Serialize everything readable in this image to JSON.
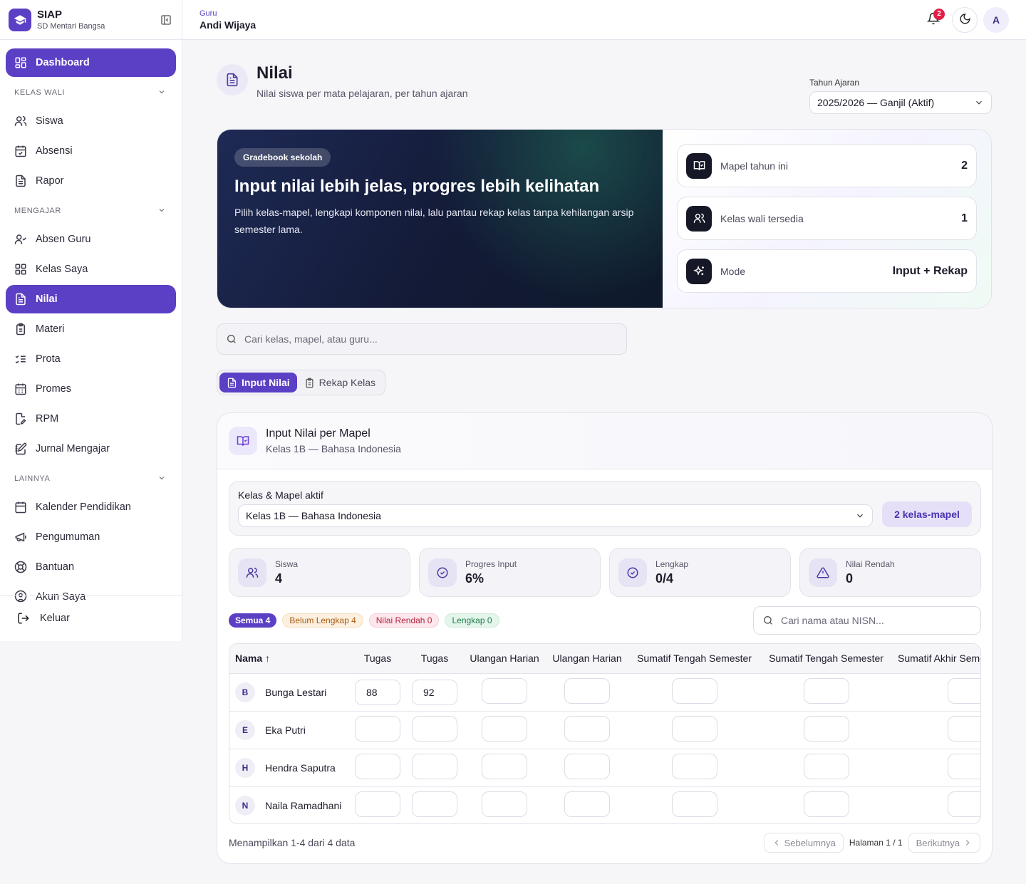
{
  "brand": {
    "name": "SIAP",
    "school": "SD Mentari Bangsa"
  },
  "sidebar": {
    "dashboard": "Dashboard",
    "sections": [
      {
        "title": "KELAS WALI",
        "items": [
          "Siswa",
          "Absensi",
          "Rapor"
        ]
      },
      {
        "title": "MENGAJAR",
        "items": [
          "Absen Guru",
          "Kelas Saya",
          "Nilai",
          "Materi",
          "Prota",
          "Promes",
          "RPM",
          "Jurnal Mengajar"
        ]
      },
      {
        "title": "LAINNYA",
        "items": [
          "Kalender Pendidikan",
          "Pengumuman",
          "Bantuan",
          "Akun Saya"
        ]
      }
    ],
    "logout": "Keluar"
  },
  "topbar": {
    "role": "Guru",
    "user_name": "Andi Wijaya",
    "notif_count": "2",
    "avatar_initial": "A"
  },
  "page": {
    "title": "Nilai",
    "subtitle": "Nilai siswa per mata pelajaran, per tahun ajaran",
    "year_label": "Tahun Ajaran",
    "year_value": "2025/2026 — Ganjil (Aktif)"
  },
  "hero": {
    "chip": "Gradebook sekolah",
    "title": "Input nilai lebih jelas, progres lebih kelihatan",
    "desc": "Pilih kelas-mapel, lengkapi komponen nilai, lalu pantau rekap kelas tanpa kehilangan arsip semester lama.",
    "stats": [
      {
        "label": "Mapel tahun ini",
        "value": "2",
        "icon": "book-check-icon"
      },
      {
        "label": "Kelas wali tersedia",
        "value": "1",
        "icon": "users-icon"
      },
      {
        "label": "Mode",
        "value": "Input + Rekap",
        "icon": "sparkles-icon"
      }
    ]
  },
  "search": {
    "placeholder": "Cari kelas, mapel, atau guru..."
  },
  "tabs": {
    "input": "Input Nilai",
    "rekap": "Rekap Kelas"
  },
  "card": {
    "title": "Input Nilai per Mapel",
    "subtitle": "Kelas 1B — Bahasa Indonesia",
    "filter_label": "Kelas & Mapel aktif",
    "filter_value": "Kelas 1B — Bahasa Indonesia",
    "filter_count": "2 kelas-mapel",
    "kpis": [
      {
        "label": "Siswa",
        "value": "4"
      },
      {
        "label": "Progres Input",
        "value": "6%"
      },
      {
        "label": "Lengkap",
        "value": "0/4"
      },
      {
        "label": "Nilai Rendah",
        "value": "0"
      }
    ],
    "chips": [
      "Semua 4",
      "Belum Lengkap 4",
      "Nilai Rendah 0",
      "Lengkap 0"
    ],
    "student_search_placeholder": "Cari nama atau NISN...",
    "table": {
      "headers": [
        "Nama ↑",
        "Tugas",
        "Tugas",
        "Ulangan Harian",
        "Ulangan Harian",
        "Sumatif Tengah Semester",
        "Sumatif Tengah Semester",
        "Sumatif Akhir Semester"
      ],
      "rows": [
        {
          "initial": "B",
          "name": "Bunga Lestari",
          "scores": [
            "88",
            "92",
            "",
            "",
            "",
            "",
            ""
          ]
        },
        {
          "initial": "E",
          "name": "Eka Putri",
          "scores": [
            "",
            "",
            "",
            "",
            "",
            "",
            ""
          ]
        },
        {
          "initial": "H",
          "name": "Hendra Saputra",
          "scores": [
            "",
            "",
            "",
            "",
            "",
            "",
            ""
          ]
        },
        {
          "initial": "N",
          "name": "Naila Ramadhani",
          "scores": [
            "",
            "",
            "",
            "",
            "",
            "",
            ""
          ]
        }
      ]
    },
    "footer_info": "Menampilkan 1-4 dari 4 data",
    "pager": {
      "prev": "Sebelumnya",
      "info": "Halaman 1 / 1",
      "next": "Berikutnya"
    }
  },
  "colors": {
    "accent": "#5b3fc4",
    "hero_dark": "#131a36",
    "danger": "#e11d48"
  }
}
